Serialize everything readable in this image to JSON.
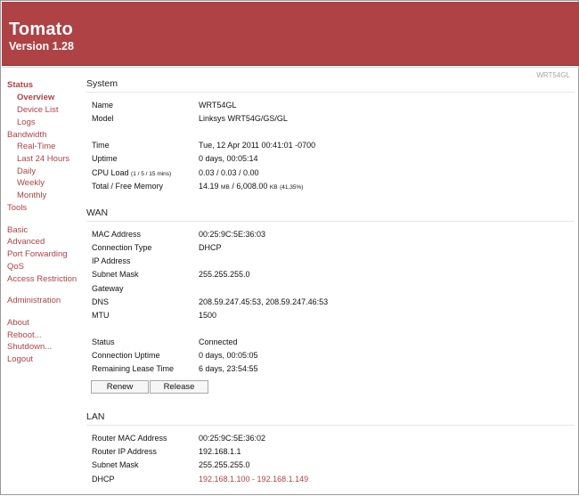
{
  "header": {
    "title": "Tomato",
    "version": "Version 1.28"
  },
  "device_name": "WRT54GL",
  "nav": {
    "status": "Status",
    "overview": "Overview",
    "device_list": "Device List",
    "logs": "Logs",
    "bandwidth": "Bandwidth",
    "real_time": "Real-Time",
    "last_24_hours": "Last 24 Hours",
    "daily": "Daily",
    "weekly": "Weekly",
    "monthly": "Monthly",
    "tools": "Tools",
    "basic": "Basic",
    "advanced": "Advanced",
    "port_forwarding": "Port Forwarding",
    "qos": "QoS",
    "access_restriction": "Access Restriction",
    "administration": "Administration",
    "about": "About",
    "reboot": "Reboot...",
    "shutdown": "Shutdown...",
    "logout": "Logout"
  },
  "system": {
    "title": "System",
    "name_label": "Name",
    "name": "WRT54GL",
    "model_label": "Model",
    "model": "Linksys WRT54G/GS/GL",
    "time_label": "Time",
    "time": "Tue, 12 Apr 2011 00:41:01 -0700",
    "uptime_label": "Uptime",
    "uptime": "0 days, 00:05:14",
    "cpu_label": "CPU Load",
    "cpu_note": "(1 / 5 / 15 mins)",
    "cpu": "0.03 / 0.03 / 0.00",
    "memory_label": "Total / Free Memory",
    "memory_total": "14.19",
    "memory_total_unit": "MB",
    "memory_sep": "/",
    "memory_free": "6,008.00",
    "memory_free_unit": "KB",
    "memory_pct": "(41.35%)"
  },
  "wan": {
    "title": "WAN",
    "mac_label": "MAC Address",
    "mac": "00:25:9C:5E:36:03",
    "conn_type_label": "Connection Type",
    "conn_type": "DHCP",
    "ip_label": "IP Address",
    "ip": "",
    "subnet_label": "Subnet Mask",
    "subnet": "255.255.255.0",
    "gateway_label": "Gateway",
    "gateway": "",
    "dns_label": "DNS",
    "dns": "208.59.247.45:53, 208.59.247.46:53",
    "mtu_label": "MTU",
    "mtu": "1500",
    "status_label": "Status",
    "status": "Connected",
    "conn_uptime_label": "Connection Uptime",
    "conn_uptime": "0 days, 00:05:05",
    "lease_label": "Remaining Lease Time",
    "lease": "6 days, 23:54:55",
    "renew": "Renew",
    "release": "Release"
  },
  "lan": {
    "title": "LAN",
    "mac_label": "Router MAC Address",
    "mac": "00:25:9C:5E:36:02",
    "ip_label": "Router IP Address",
    "ip": "192.168.1.1",
    "subnet_label": "Subnet Mask",
    "subnet": "255.255.255.0",
    "dhcp_label": "DHCP",
    "dhcp": "192.168.1.100 - 192.168.1.149"
  }
}
